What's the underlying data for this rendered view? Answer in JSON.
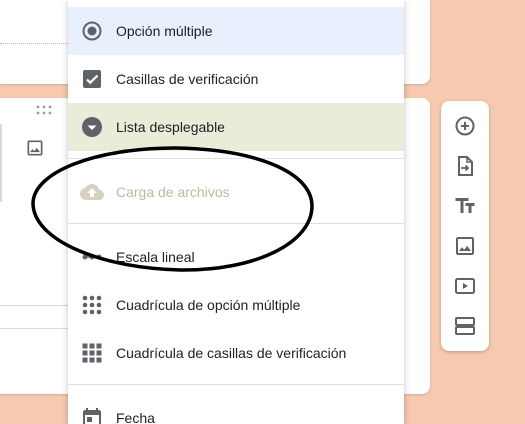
{
  "menu": {
    "items": [
      {
        "label": "Opción múltiple",
        "icon": "radio-button-icon"
      },
      {
        "label": "Casillas de verificación",
        "icon": "checkbox-icon"
      },
      {
        "label": "Lista desplegable",
        "icon": "dropdown-circle-icon"
      },
      {
        "label": "Carga de archivos",
        "icon": "cloud-upload-icon"
      },
      {
        "label": "Escala lineal",
        "icon": "linear-scale-icon"
      },
      {
        "label": "Cuadrícula de opción múltiple",
        "icon": "dot-grid-icon"
      },
      {
        "label": "Cuadrícula de casillas de verificación",
        "icon": "checkbox-grid-icon"
      },
      {
        "label": "Fecha",
        "icon": "calendar-icon"
      }
    ],
    "selected": "Opción múltiple",
    "highlighted": "Lista desplegable",
    "disabled": "Carga de archivos"
  },
  "toolbar": {
    "icons": [
      "add-question-icon",
      "import-questions-icon",
      "add-title-icon",
      "add-image-icon",
      "add-video-icon",
      "add-section-icon"
    ]
  },
  "colors": {
    "page_background": "#f6c9b0",
    "selected_item": "#e8f0fe",
    "highlighted_item": "#e8ecd8",
    "icon": "#5f6368",
    "disabled_text": "#c2b89c",
    "annotation": "#000000"
  }
}
